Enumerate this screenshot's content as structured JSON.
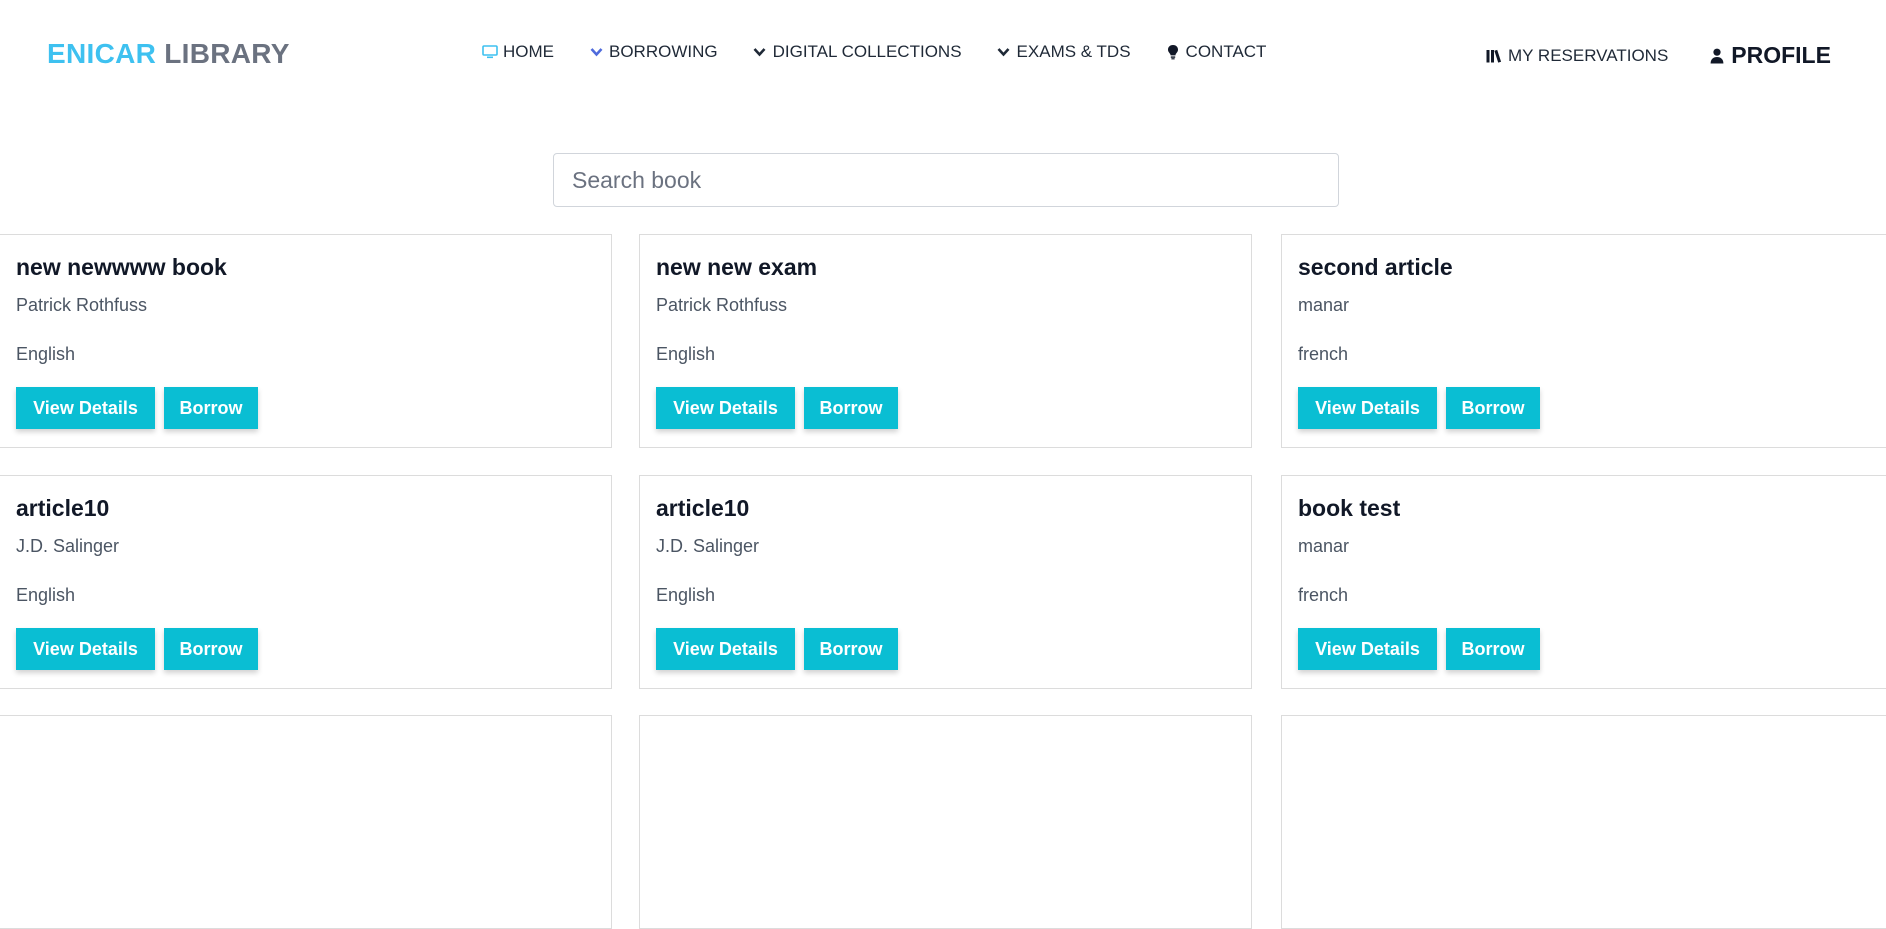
{
  "brand": {
    "part1": "ENICAR",
    "part2": "LIBRARY"
  },
  "nav": {
    "items": [
      {
        "label": "HOME",
        "icon": "monitor-icon"
      },
      {
        "label": "BORROWING",
        "icon": "chevron-down-icon"
      },
      {
        "label": "DIGITAL COLLECTIONS",
        "icon": "chevron-down-icon"
      },
      {
        "label": "EXAMS & TDS",
        "icon": "chevron-down-icon"
      },
      {
        "label": "CONTACT",
        "icon": "lightbulb-icon"
      }
    ],
    "reservations": {
      "label": "MY RESERVATIONS",
      "icon": "books-icon"
    },
    "profile": {
      "label": "PROFILE",
      "icon": "user-icon"
    }
  },
  "search": {
    "placeholder": "Search book",
    "value": ""
  },
  "books": [
    {
      "title": "new newwww book",
      "author": "Patrick Rothfuss",
      "language": "English"
    },
    {
      "title": "new new exam",
      "author": "Patrick Rothfuss",
      "language": "English"
    },
    {
      "title": "second article",
      "author": "manar",
      "language": "french"
    },
    {
      "title": "article10",
      "author": "J.D. Salinger",
      "language": "English"
    },
    {
      "title": "article10",
      "author": "J.D. Salinger",
      "language": "English"
    },
    {
      "title": "book test",
      "author": "manar",
      "language": "french"
    },
    {
      "title": "",
      "author": "",
      "language": ""
    },
    {
      "title": "",
      "author": "",
      "language": ""
    },
    {
      "title": "",
      "author": "",
      "language": ""
    }
  ],
  "buttons": {
    "details": "View Details",
    "borrow": "Borrow"
  },
  "colors": {
    "accent": "#0abed3",
    "brand_primary": "#3ec1f0",
    "brand_secondary": "#6b7280",
    "home_icon": "#3ec1f0",
    "borrowing_icon": "#4f6bdc"
  }
}
